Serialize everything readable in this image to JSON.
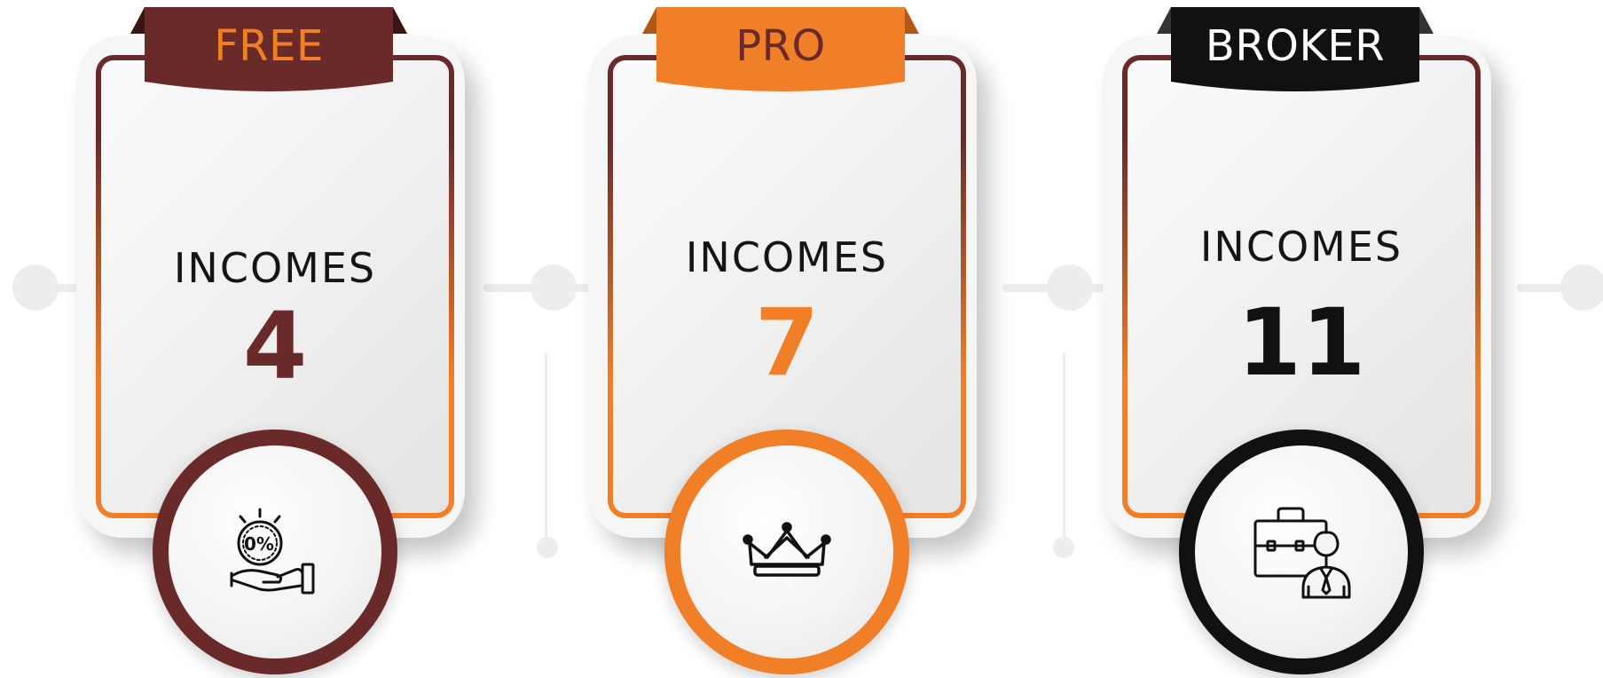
{
  "colors": {
    "maroon": "#6b2a2a",
    "orange": "#f07f27",
    "black": "#111111",
    "connector": "#ececec"
  },
  "plans": [
    {
      "title": "FREE",
      "label": "INCOMES",
      "value": "4",
      "ribbon_color": "#6b2a2a",
      "title_color": "#f07f27",
      "value_color": "#6b2a2a",
      "badge_color": "#6b2a2a",
      "icon": "hand-percent-coin-icon"
    },
    {
      "title": "PRO",
      "label": "INCOMES",
      "value": "7",
      "ribbon_color": "#f07f27",
      "title_color": "#6b2a2a",
      "value_color": "#f07f27",
      "badge_color": "#f07f27",
      "icon": "crown-icon"
    },
    {
      "title": "BROKER",
      "label": "INCOMES",
      "value": "11",
      "ribbon_color": "#111111",
      "title_color": "#ffffff",
      "value_color": "#111111",
      "badge_color": "#111111",
      "icon": "businessman-briefcase-icon"
    }
  ]
}
